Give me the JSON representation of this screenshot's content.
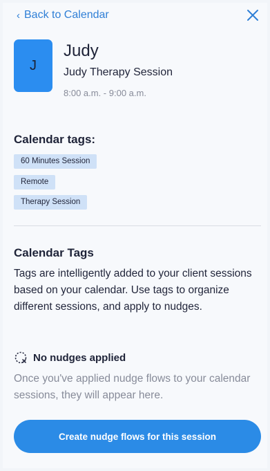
{
  "header": {
    "back_label": "Back to Calendar",
    "back_icon": "chevron-left-icon",
    "close_icon": "close-icon"
  },
  "client": {
    "initial": "J",
    "name": "Judy",
    "session_name": "Judy Therapy Session",
    "time": "8:00 a.m. - 9:00 a.m."
  },
  "calendar_tags": {
    "heading": "Calendar tags:",
    "tags": [
      "60 Minutes Session",
      "Remote",
      "Therapy Session"
    ]
  },
  "info": {
    "heading": "Calendar Tags",
    "text": "Tags are intelligently added to your client sessions based on your calendar. Use tags to organize different sessions, and apply to nudges."
  },
  "nudges": {
    "icon": "no-nudges-icon",
    "title": "No nudges applied",
    "description": "Once you've applied nudge flows to your calendar sessions, they will appear here."
  },
  "cta": {
    "label": "Create nudge flows for this session"
  },
  "colors": {
    "accent": "#2b8be6",
    "link": "#2f7fd6",
    "tag_bg": "#cfe1f7",
    "avatar_bg": "#2b8df0"
  }
}
